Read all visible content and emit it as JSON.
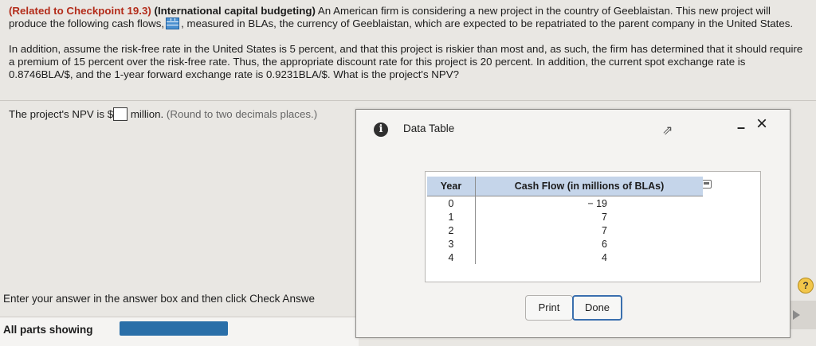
{
  "question": {
    "label": "(Related to Checkpoint 19.3)",
    "title": "(International capital budgeting)",
    "line1_before_icon": "An American firm is considering a new project in the country of Geeblaistan. This new project will produce the following cash flows,",
    "line1_after_icon": ", measured in BLAs, the currency of Geeblaistan, which are expected to be repatriated to the parent company in the United States.",
    "para2": "In addition, assume the risk-free rate in the United States is 5 percent, and that this project is riskier than most and, as such, the firm has determined that it should require a premium of 15 percent over the risk-free rate. Thus, the appropriate discount rate for this project is 20 percent. In addition, the current spot exchange rate is 0.8746BLA/$, and the 1-year forward exchange rate is 0.9231BLA/$. What is the project's NPV?"
  },
  "answer": {
    "prefix": "The project's NPV is $",
    "suffix": "million.",
    "hint": "(Round to two decimals places.)",
    "value": ""
  },
  "footer": {
    "instruction": "Enter your answer in the answer box and then click Check Answe",
    "parts_label": "All parts showing"
  },
  "dialog": {
    "title": "Data Table",
    "icons": [
      "info-icon",
      "minimize-icon",
      "close-icon",
      "copy-icon",
      "cursor-icon"
    ],
    "minimize_glyph": "–",
    "close_glyph": "×",
    "table": {
      "headers": [
        "Year",
        "Cash Flow (in millions of BLAs)"
      ],
      "rows": [
        {
          "year": "0",
          "cash_flow": "− 19"
        },
        {
          "year": "1",
          "cash_flow": "7"
        },
        {
          "year": "2",
          "cash_flow": "7"
        },
        {
          "year": "3",
          "cash_flow": "6"
        },
        {
          "year": "4",
          "cash_flow": "4"
        }
      ]
    },
    "buttons": {
      "print": "Print",
      "done": "Done"
    }
  },
  "help_label": "?",
  "colors": {
    "accent": "#2a6fa8",
    "header_bg": "#c5d5ea",
    "question_label": "#b32c1a"
  }
}
